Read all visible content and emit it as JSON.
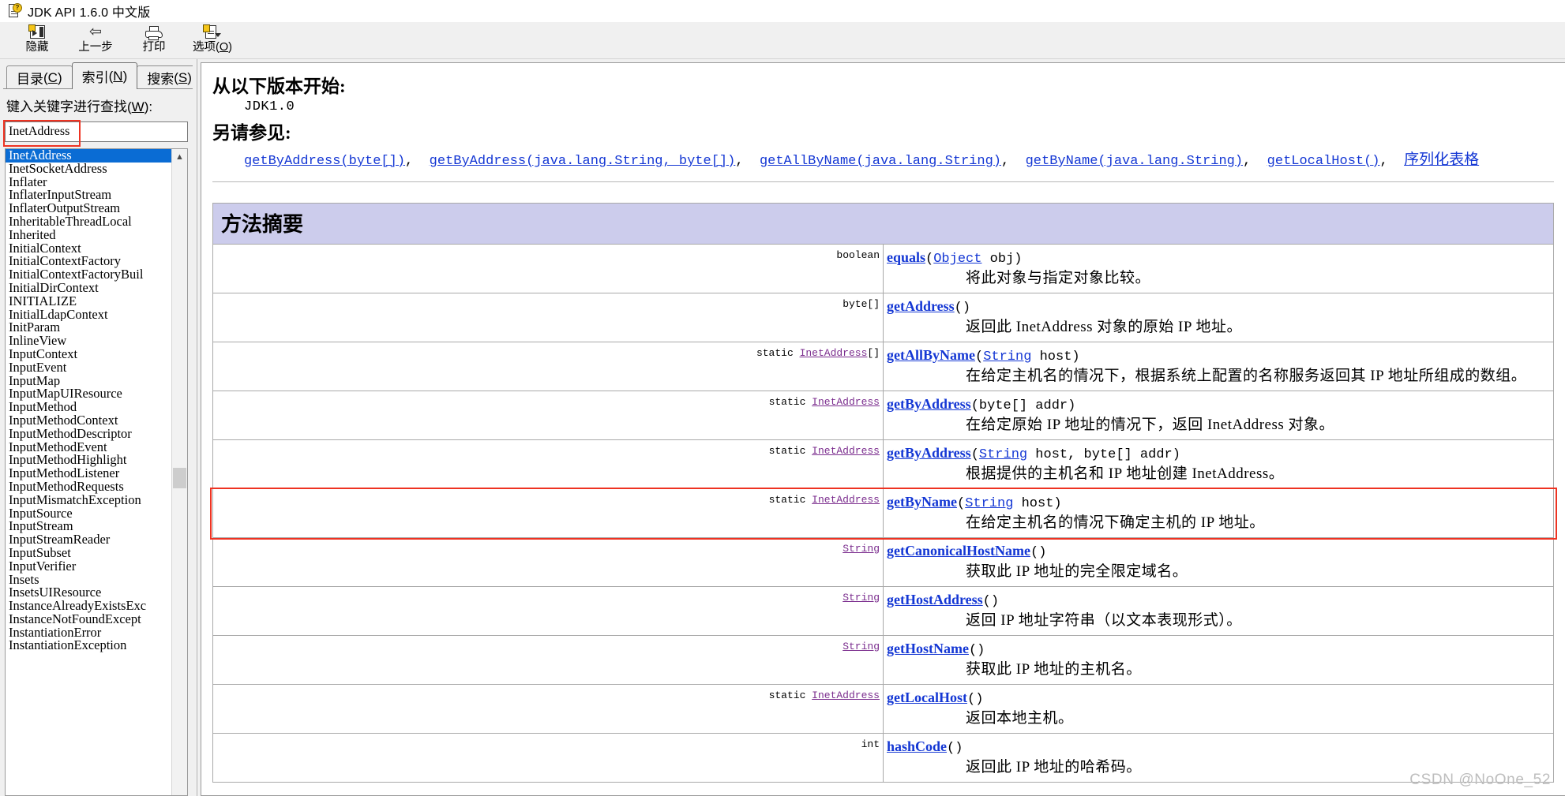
{
  "window": {
    "title": "JDK API 1.6.0 中文版",
    "icon": "help-document-icon"
  },
  "toolbar": {
    "buttons": [
      {
        "label": "隐藏",
        "icon": "hide-pane-icon"
      },
      {
        "label": "上一步",
        "icon": "back-arrow-icon"
      },
      {
        "label": "打印",
        "icon": "printer-icon"
      },
      {
        "label": "选项",
        "accel": "O",
        "icon": "options-page-icon"
      }
    ]
  },
  "left_pane": {
    "tabs": [
      {
        "label": "目录",
        "accel": "C",
        "active": false
      },
      {
        "label": "索引",
        "accel": "N",
        "active": true
      },
      {
        "label": "搜索",
        "accel": "S",
        "active": false
      }
    ],
    "prompt": {
      "text": "键入关键字进行查找",
      "accel": "W",
      "suffix": ":"
    },
    "search": {
      "value": "InetAddress",
      "placeholder": ""
    },
    "index_items": [
      "InetAddress",
      "InetSocketAddress",
      "Inflater",
      "InflaterInputStream",
      "InflaterOutputStream",
      "InheritableThreadLocal",
      "Inherited",
      "InitialContext",
      "InitialContextFactory",
      "InitialContextFactoryBuil",
      "InitialDirContext",
      "INITIALIZE",
      "InitialLdapContext",
      "InitParam",
      "InlineView",
      "InputContext",
      "InputEvent",
      "InputMap",
      "InputMapUIResource",
      "InputMethod",
      "InputMethodContext",
      "InputMethodDescriptor",
      "InputMethodEvent",
      "InputMethodHighlight",
      "InputMethodListener",
      "InputMethodRequests",
      "InputMismatchException",
      "InputSource",
      "InputStream",
      "InputStreamReader",
      "InputSubset",
      "InputVerifier",
      "Insets",
      "InsetsUIResource",
      "InstanceAlreadyExistsExc",
      "InstanceNotFoundExcept",
      "InstantiationError",
      "InstantiationException"
    ],
    "selected_index": 0
  },
  "document": {
    "since_heading": "从以下版本开始:",
    "since_value": "JDK1.0",
    "seealso_heading": "另请参见:",
    "seealso_links": [
      "getByAddress(byte[])",
      "getByAddress(java.lang.String, byte[])",
      "getAllByName(java.lang.String)",
      "getByName(java.lang.String)",
      "getLocalHost()",
      "序列化表格"
    ],
    "summary_title": "方法摘要",
    "methods": [
      {
        "modifier": "",
        "type": "boolean",
        "type_link": false,
        "type_suffix": "",
        "name": "equals",
        "params_open": "(",
        "param_type": "Object",
        "param_type_link": true,
        "param_rest": " obj)",
        "description": "将此对象与指定对象比较。",
        "highlighted": false
      },
      {
        "modifier": "",
        "type": "byte[]",
        "type_link": false,
        "type_suffix": "",
        "name": "getAddress",
        "params_open": "(",
        "param_type": "",
        "param_type_link": false,
        "param_rest": ")",
        "description": "返回此 InetAddress 对象的原始 IP 地址。",
        "highlighted": false
      },
      {
        "modifier": "static ",
        "type": "InetAddress",
        "type_link": true,
        "type_suffix": "[]",
        "name": "getAllByName",
        "params_open": "(",
        "param_type": "String",
        "param_type_link": true,
        "param_rest": " host)",
        "description": "在给定主机名的情况下，根据系统上配置的名称服务返回其 IP 地址所组成的数组。",
        "highlighted": false
      },
      {
        "modifier": "static ",
        "type": "InetAddress",
        "type_link": true,
        "type_suffix": "",
        "name": "getByAddress",
        "params_open": "(",
        "param_type": "",
        "param_type_link": false,
        "param_rest": "byte[] addr)",
        "description": "在给定原始 IP 地址的情况下，返回 InetAddress 对象。",
        "highlighted": false
      },
      {
        "modifier": "static ",
        "type": "InetAddress",
        "type_link": true,
        "type_suffix": "",
        "name": "getByAddress",
        "params_open": "(",
        "param_type": "String",
        "param_type_link": true,
        "param_rest": " host, byte[] addr)",
        "description": "根据提供的主机名和 IP 地址创建 InetAddress。",
        "highlighted": false
      },
      {
        "modifier": "static ",
        "type": "InetAddress",
        "type_link": true,
        "type_suffix": "",
        "name": "getByName",
        "params_open": "(",
        "param_type": "String",
        "param_type_link": true,
        "param_rest": " host)",
        "description": "在给定主机名的情况下确定主机的 IP 地址。",
        "highlighted": true
      },
      {
        "modifier": "",
        "type": "String",
        "type_link": true,
        "type_suffix": "",
        "name": "getCanonicalHostName",
        "params_open": "(",
        "param_type": "",
        "param_type_link": false,
        "param_rest": ")",
        "description": "获取此 IP 地址的完全限定域名。",
        "highlighted": false
      },
      {
        "modifier": "",
        "type": "String",
        "type_link": true,
        "type_suffix": "",
        "name": "getHostAddress",
        "params_open": "(",
        "param_type": "",
        "param_type_link": false,
        "param_rest": ")",
        "description": "返回 IP 地址字符串（以文本表现形式）。",
        "highlighted": false
      },
      {
        "modifier": "",
        "type": "String",
        "type_link": true,
        "type_suffix": "",
        "name": "getHostName",
        "params_open": "(",
        "param_type": "",
        "param_type_link": false,
        "param_rest": ")",
        "description": "获取此 IP 地址的主机名。",
        "highlighted": false
      },
      {
        "modifier": "static ",
        "type": "InetAddress",
        "type_link": true,
        "type_suffix": "",
        "name": "getLocalHost",
        "params_open": "(",
        "param_type": "",
        "param_type_link": false,
        "param_rest": ")",
        "description": "返回本地主机。",
        "highlighted": false
      },
      {
        "modifier": "",
        "type": "int",
        "type_link": false,
        "type_suffix": "",
        "name": "hashCode",
        "params_open": "(",
        "param_type": "",
        "param_type_link": false,
        "param_rest": ")",
        "description": "返回此 IP 地址的哈希码。",
        "highlighted": false
      }
    ]
  },
  "watermark": "CSDN @NoOne_52",
  "colors": {
    "selection_blue": "#0a6cd4",
    "link_blue": "#1437d4",
    "visited_purple": "#7b2d8e",
    "summary_header_bg": "#ccccec",
    "annotation_red": "#ee3322"
  }
}
